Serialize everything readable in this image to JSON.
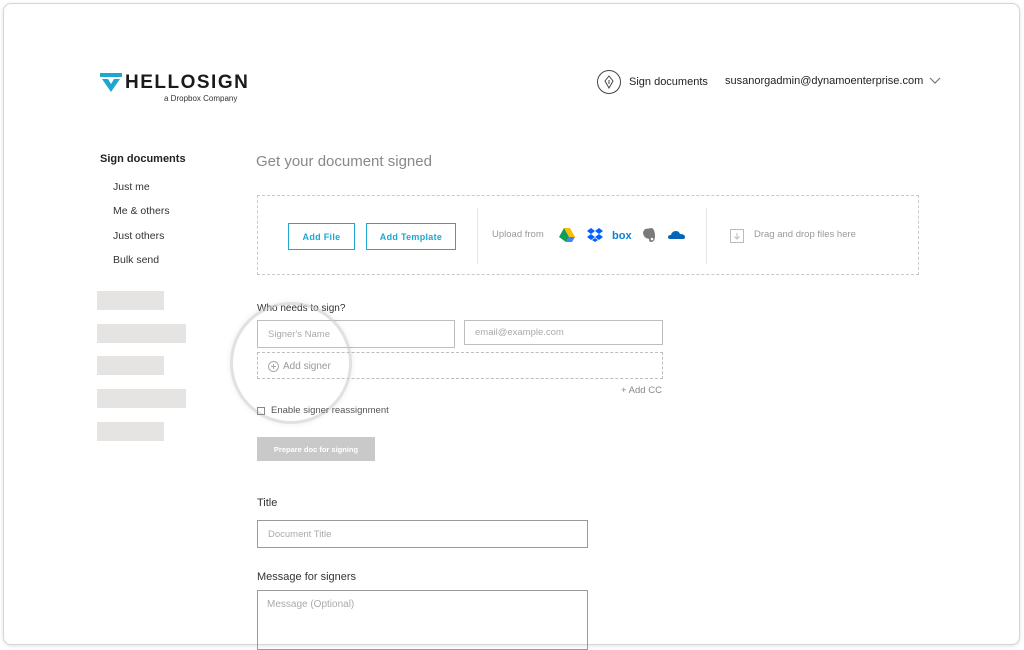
{
  "header": {
    "logo_word": "HELLOSIGN",
    "logo_sub": "a Dropbox Company",
    "sign_documents": "Sign documents",
    "account_email": "susanorgadmin@dynamoenterprise.com"
  },
  "sidebar": {
    "title": "Sign documents",
    "items": [
      {
        "label": "Just me"
      },
      {
        "label": "Me & others"
      },
      {
        "label": "Just others"
      },
      {
        "label": "Bulk send"
      }
    ]
  },
  "main": {
    "title": "Get your document signed",
    "upload": {
      "add_file": "Add File",
      "add_template": "Add Template",
      "upload_from": "Upload from",
      "services": [
        "google-drive-icon",
        "dropbox-icon",
        "box-icon",
        "evernote-icon",
        "onedrive-icon"
      ],
      "drag_drop": "Drag and drop files here"
    },
    "signers": {
      "label": "Who needs to sign?",
      "name_placeholder": "Signer's Name",
      "email_placeholder": "email@example.com",
      "add_signer": "Add signer",
      "add_cc": "+ Add CC",
      "enable_reassignment": "Enable signer reassignment",
      "prepare_button": "Prepare doc for signing"
    },
    "title_field": {
      "label": "Title",
      "placeholder": "Document Title"
    },
    "message_field": {
      "label": "Message for signers",
      "placeholder": "Message (Optional)"
    }
  },
  "colors": {
    "accent": "#1ea7d0",
    "placeholder_block": "#e6e3e3",
    "disabled_button": "#c9c9c9"
  }
}
